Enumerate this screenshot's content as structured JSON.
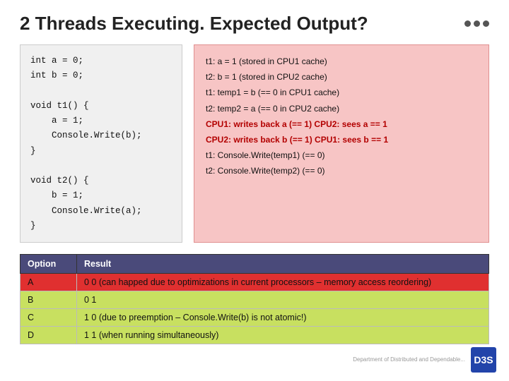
{
  "title": "2 Threads Executing. Expected Output?",
  "dots": [
    "●",
    "●",
    "●"
  ],
  "code": "int a = 0;\nint b = 0;\n\nvoid t1() {\n    a = 1;\n    Console.Write(b);\n}\n\nvoid t2() {\n    b = 1;\n    Console.Write(a);\n}",
  "output_lines": [
    {
      "text": "t1: a = 1 (stored in CPU1 cache)",
      "highlight": false
    },
    {
      "text": "t2: b = 1 (stored in CPU2 cache)",
      "highlight": false
    },
    {
      "text": "t1: temp1 = b (== 0 in CPU1 cache)",
      "highlight": false
    },
    {
      "text": "t2: temp2 = a (== 0 in CPU2 cache)",
      "highlight": false
    },
    {
      "text": "CPU1: writes back a (== 1) CPU2: sees a == 1",
      "highlight": true
    },
    {
      "text": "CPU2: writes back b (== 1) CPU1: sees b == 1",
      "highlight": true
    },
    {
      "text": "t1: Console.Write(temp1) (== 0)",
      "highlight": false
    },
    {
      "text": "t2: Console.Write(temp2) (== 0)",
      "highlight": false
    }
  ],
  "table": {
    "headers": [
      "Option",
      "Result"
    ],
    "rows": [
      {
        "option": "A",
        "result": "0 0 (can happed due to optimizations in current processors – memory access reordering)",
        "type": "red"
      },
      {
        "option": "B",
        "result": "0 1",
        "type": "green"
      },
      {
        "option": "C",
        "result": "1 0 (due to preemption – Console.Write(b) is not atomic!)",
        "type": "green"
      },
      {
        "option": "D",
        "result": "1 1 (when running simultaneously)",
        "type": "green"
      }
    ]
  },
  "footer": {
    "dept_text": "Department of\nDistributed and\nDependable...",
    "logo_text": "D3S"
  }
}
